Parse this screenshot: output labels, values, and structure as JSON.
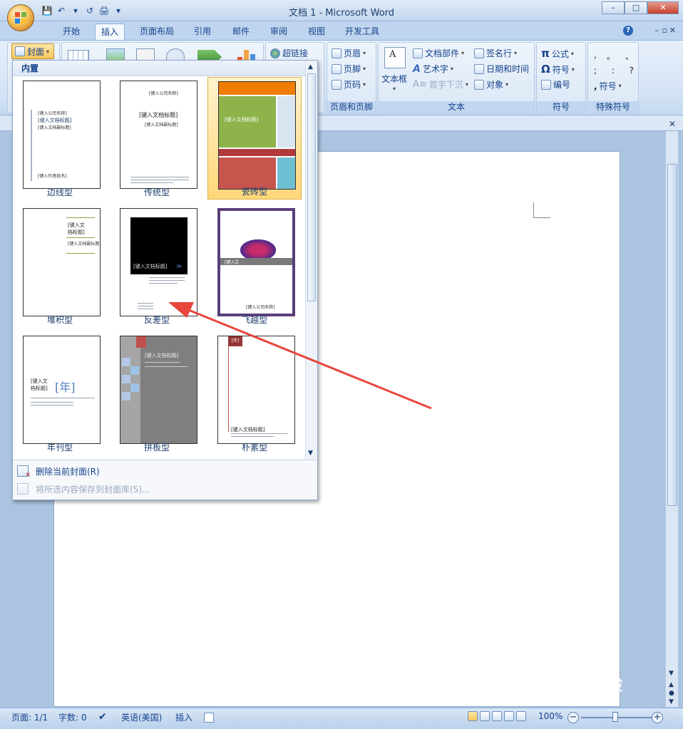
{
  "window": {
    "title": "文档 1 - Microsoft Word",
    "controls": {
      "minimize": "–",
      "maximize": "□",
      "close": "✕"
    }
  },
  "qat": {
    "save": "💾",
    "undo": "↶",
    "undo_dd": "▾",
    "redo": "↺",
    "print": "🖨",
    "customize": "▾"
  },
  "tabs": [
    {
      "label": "开始"
    },
    {
      "label": "插入"
    },
    {
      "label": "页面布局"
    },
    {
      "label": "引用"
    },
    {
      "label": "邮件"
    },
    {
      "label": "审阅"
    },
    {
      "label": "视图"
    },
    {
      "label": "开发工具"
    }
  ],
  "active_tab": "插入",
  "help": "?",
  "ribbon": {
    "cover_button": "封面",
    "links": {
      "hyperlink": "超链接"
    },
    "header_footer": {
      "header": "页眉",
      "footer": "页脚",
      "page_number": "页码",
      "group_label": "页眉和页脚"
    },
    "text": {
      "textbox": "文本框",
      "quick_parts": "文档部件",
      "wordart": "艺术字",
      "dropcap": "首字下沉",
      "signature": "签名行",
      "datetime": "日期和时间",
      "object": "对象",
      "group_label": "文本"
    },
    "symbols": {
      "equation": "公式",
      "symbol": "符号",
      "number": "编号",
      "group_label": "符号"
    },
    "special": {
      "row1": [
        ",",
        "。",
        "、"
      ],
      "row2": [
        ";",
        ":",
        "?"
      ],
      "symbol": "符号",
      "group_label": "特殊符号"
    }
  },
  "gallery": {
    "header": "内置",
    "items": [
      {
        "label": "边线型"
      },
      {
        "label": "传统型"
      },
      {
        "label": "瓷砖型"
      },
      {
        "label": "堆积型"
      },
      {
        "label": "反差型"
      },
      {
        "label": "飞越型"
      },
      {
        "label": "年刊型"
      },
      {
        "label": "拼板型"
      },
      {
        "label": "朴素型"
      }
    ],
    "selected": "瓷砖型",
    "thumb_text": {
      "title": "[键入文档标题]",
      "title_short1": "[键入文",
      "title_short2": "档标题]",
      "year": "[年]",
      "subtitle": "[键入文档副标题]",
      "company": "[键入公司名称]"
    },
    "footer": {
      "delete": "删除当前封面(R)",
      "save": "将所选内容保存到封面库(S)..."
    }
  },
  "status": {
    "page": "页面: 1/1",
    "words": "字数: 0",
    "language": "英语(美国)",
    "mode": "插入",
    "zoom": "100%",
    "zoom_out": "−",
    "zoom_in": "+"
  },
  "watermark": {
    "brand": "Baidu经验",
    "url": "jingyan.baidu.com"
  },
  "colors": {
    "arrow": "#e8453c",
    "accent": "#15428b",
    "ribbon_bg": "#d4e3f5"
  }
}
